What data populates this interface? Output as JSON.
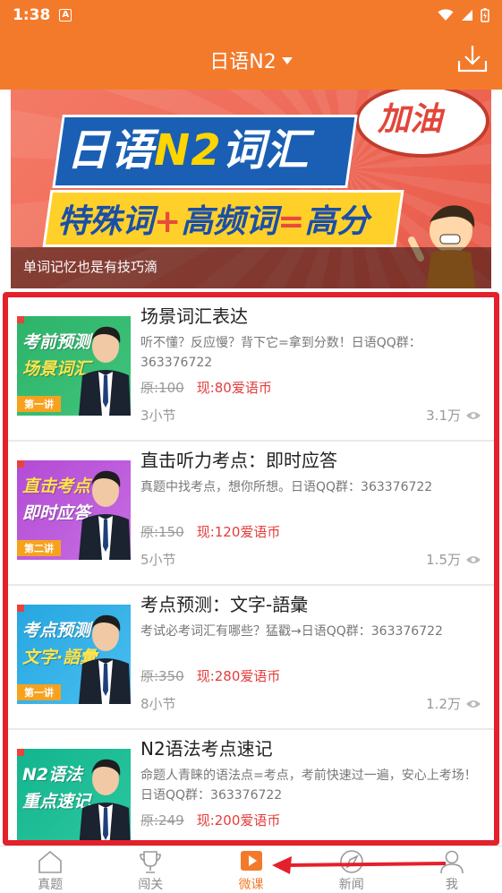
{
  "status_bar": {
    "time": "1:38"
  },
  "header": {
    "title": "日语N2"
  },
  "banner": {
    "headline": "日语N2词汇",
    "headline_parts": [
      "日语",
      "N2",
      "词汇"
    ],
    "formula": [
      "特殊词",
      "+",
      "高频词",
      "=",
      "高分"
    ],
    "bubble": "加油",
    "caption": "单词记忆也是有技巧滴"
  },
  "courses": [
    {
      "title": "场景词汇表达",
      "description": "听不懂？反应慢？背下它=拿到分数！日语QQ群：363376722",
      "original_price": "原:100",
      "current_price": "现:80爱语币",
      "sections": "3小节",
      "views": "3.1万",
      "thumb": {
        "line1": "考前预测",
        "line2": "场景词汇",
        "lesson": "第一讲",
        "theme": "green"
      }
    },
    {
      "title": "直击听力考点：即时应答",
      "description": "真题中找考点，想你所想。日语QQ群：363376722",
      "original_price": "原:150",
      "current_price": "现:120爱语币",
      "sections": "5小节",
      "views": "1.5万",
      "thumb": {
        "line1": "直击考点",
        "line2": "即时应答",
        "lesson": "第二讲",
        "theme": "purple"
      }
    },
    {
      "title": "考点预测：文字-語彙",
      "description": "考试必考词汇有哪些？猛戳→日语QQ群：363376722",
      "original_price": "原:350",
      "current_price": "现:280爱语币",
      "sections": "8小节",
      "views": "1.2万",
      "thumb": {
        "line1": "考点预测",
        "line2": "文字·語彙",
        "lesson": "第一讲",
        "theme": "blue"
      }
    },
    {
      "title": "N2语法考点速记",
      "description": "命题人青睐的语法点=考点，考前快速过一遍，安心上考场！日语QQ群：363376722",
      "original_price": "原:249",
      "current_price": "现:200爱语币",
      "sections": "",
      "views": "",
      "thumb": {
        "line1": "N2语法",
        "line2": "重点速记",
        "lesson": "",
        "theme": "teal"
      }
    }
  ],
  "bottom_nav": [
    {
      "label": "真题",
      "icon": "house-icon"
    },
    {
      "label": "闯关",
      "icon": "trophy-icon"
    },
    {
      "label": "微课",
      "icon": "play-icon",
      "active": true
    },
    {
      "label": "新闻",
      "icon": "compass-icon"
    },
    {
      "label": "我",
      "icon": "person-icon"
    }
  ],
  "colors": {
    "primary": "#f37a2b",
    "price": "#e43c3c",
    "highlight": "#e5202a"
  }
}
